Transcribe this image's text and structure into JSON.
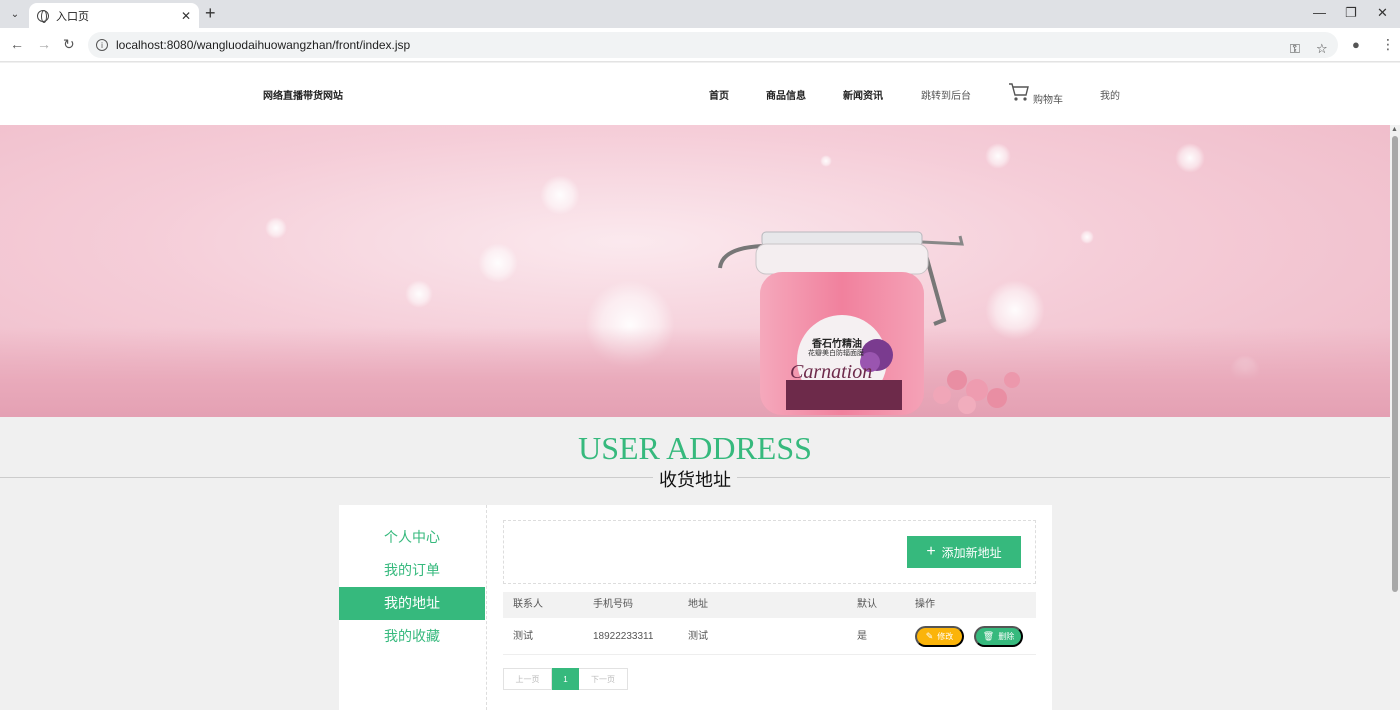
{
  "browser": {
    "tab_title": "入口页",
    "url": "localhost:8080/wangluodaihuowangzhan/front/index.jsp"
  },
  "site": {
    "logo_text": "网络直播带货网站",
    "nav": {
      "home": "首页",
      "products": "商品信息",
      "news": "新闻资讯",
      "admin": "跳转到后台",
      "cart": "购物车",
      "mine": "我的"
    }
  },
  "banner": {
    "product_title": "香石竹精油",
    "product_subtitle": "花瓣美白防辐面膜",
    "product_brand": "Carnation"
  },
  "section": {
    "title_en": "USER ADDRESS",
    "title_cn": "收货地址"
  },
  "side_menu": {
    "items": [
      {
        "label": "个人中心",
        "active": false
      },
      {
        "label": "我的订单",
        "active": false
      },
      {
        "label": "我的地址",
        "active": true
      },
      {
        "label": "我的收藏",
        "active": false
      }
    ]
  },
  "address": {
    "add_button": "添加新地址",
    "columns": [
      "联系人",
      "手机号码",
      "地址",
      "默认",
      "操作"
    ],
    "rows": [
      {
        "contact": "测试",
        "phone": "18922233311",
        "address": "测试",
        "default": "是",
        "edit_label": "修改",
        "delete_label": "删除"
      }
    ]
  },
  "pagination": {
    "prev": "上一页",
    "current": "1",
    "next": "下一页"
  },
  "colors": {
    "accent": "#36b97d",
    "edit": "#fbb40a"
  }
}
